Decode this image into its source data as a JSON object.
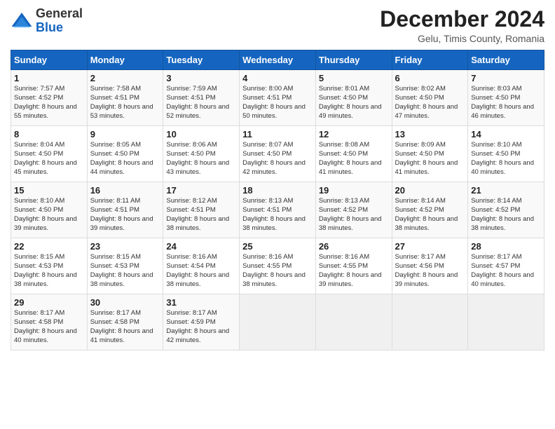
{
  "logo": {
    "general": "General",
    "blue": "Blue"
  },
  "header": {
    "title": "December 2024",
    "subtitle": "Gelu, Timis County, Romania"
  },
  "weekdays": [
    "Sunday",
    "Monday",
    "Tuesday",
    "Wednesday",
    "Thursday",
    "Friday",
    "Saturday"
  ],
  "weeks": [
    [
      {
        "day": "1",
        "sunrise": "7:57 AM",
        "sunset": "4:52 PM",
        "daylight": "8 hours and 55 minutes."
      },
      {
        "day": "2",
        "sunrise": "7:58 AM",
        "sunset": "4:51 PM",
        "daylight": "8 hours and 53 minutes."
      },
      {
        "day": "3",
        "sunrise": "7:59 AM",
        "sunset": "4:51 PM",
        "daylight": "8 hours and 52 minutes."
      },
      {
        "day": "4",
        "sunrise": "8:00 AM",
        "sunset": "4:51 PM",
        "daylight": "8 hours and 50 minutes."
      },
      {
        "day": "5",
        "sunrise": "8:01 AM",
        "sunset": "4:50 PM",
        "daylight": "8 hours and 49 minutes."
      },
      {
        "day": "6",
        "sunrise": "8:02 AM",
        "sunset": "4:50 PM",
        "daylight": "8 hours and 47 minutes."
      },
      {
        "day": "7",
        "sunrise": "8:03 AM",
        "sunset": "4:50 PM",
        "daylight": "8 hours and 46 minutes."
      }
    ],
    [
      {
        "day": "8",
        "sunrise": "8:04 AM",
        "sunset": "4:50 PM",
        "daylight": "8 hours and 45 minutes."
      },
      {
        "day": "9",
        "sunrise": "8:05 AM",
        "sunset": "4:50 PM",
        "daylight": "8 hours and 44 minutes."
      },
      {
        "day": "10",
        "sunrise": "8:06 AM",
        "sunset": "4:50 PM",
        "daylight": "8 hours and 43 minutes."
      },
      {
        "day": "11",
        "sunrise": "8:07 AM",
        "sunset": "4:50 PM",
        "daylight": "8 hours and 42 minutes."
      },
      {
        "day": "12",
        "sunrise": "8:08 AM",
        "sunset": "4:50 PM",
        "daylight": "8 hours and 41 minutes."
      },
      {
        "day": "13",
        "sunrise": "8:09 AM",
        "sunset": "4:50 PM",
        "daylight": "8 hours and 41 minutes."
      },
      {
        "day": "14",
        "sunrise": "8:10 AM",
        "sunset": "4:50 PM",
        "daylight": "8 hours and 40 minutes."
      }
    ],
    [
      {
        "day": "15",
        "sunrise": "8:10 AM",
        "sunset": "4:50 PM",
        "daylight": "8 hours and 39 minutes."
      },
      {
        "day": "16",
        "sunrise": "8:11 AM",
        "sunset": "4:51 PM",
        "daylight": "8 hours and 39 minutes."
      },
      {
        "day": "17",
        "sunrise": "8:12 AM",
        "sunset": "4:51 PM",
        "daylight": "8 hours and 38 minutes."
      },
      {
        "day": "18",
        "sunrise": "8:13 AM",
        "sunset": "4:51 PM",
        "daylight": "8 hours and 38 minutes."
      },
      {
        "day": "19",
        "sunrise": "8:13 AM",
        "sunset": "4:52 PM",
        "daylight": "8 hours and 38 minutes."
      },
      {
        "day": "20",
        "sunrise": "8:14 AM",
        "sunset": "4:52 PM",
        "daylight": "8 hours and 38 minutes."
      },
      {
        "day": "21",
        "sunrise": "8:14 AM",
        "sunset": "4:52 PM",
        "daylight": "8 hours and 38 minutes."
      }
    ],
    [
      {
        "day": "22",
        "sunrise": "8:15 AM",
        "sunset": "4:53 PM",
        "daylight": "8 hours and 38 minutes."
      },
      {
        "day": "23",
        "sunrise": "8:15 AM",
        "sunset": "4:53 PM",
        "daylight": "8 hours and 38 minutes."
      },
      {
        "day": "24",
        "sunrise": "8:16 AM",
        "sunset": "4:54 PM",
        "daylight": "8 hours and 38 minutes."
      },
      {
        "day": "25",
        "sunrise": "8:16 AM",
        "sunset": "4:55 PM",
        "daylight": "8 hours and 38 minutes."
      },
      {
        "day": "26",
        "sunrise": "8:16 AM",
        "sunset": "4:55 PM",
        "daylight": "8 hours and 39 minutes."
      },
      {
        "day": "27",
        "sunrise": "8:17 AM",
        "sunset": "4:56 PM",
        "daylight": "8 hours and 39 minutes."
      },
      {
        "day": "28",
        "sunrise": "8:17 AM",
        "sunset": "4:57 PM",
        "daylight": "8 hours and 40 minutes."
      }
    ],
    [
      {
        "day": "29",
        "sunrise": "8:17 AM",
        "sunset": "4:58 PM",
        "daylight": "8 hours and 40 minutes."
      },
      {
        "day": "30",
        "sunrise": "8:17 AM",
        "sunset": "4:58 PM",
        "daylight": "8 hours and 41 minutes."
      },
      {
        "day": "31",
        "sunrise": "8:17 AM",
        "sunset": "4:59 PM",
        "daylight": "8 hours and 42 minutes."
      },
      null,
      null,
      null,
      null
    ]
  ]
}
